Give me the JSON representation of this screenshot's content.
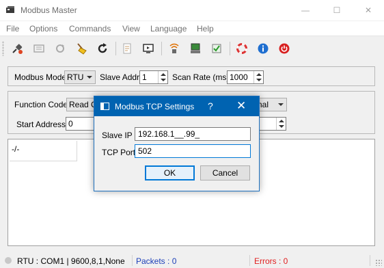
{
  "window": {
    "title": "Modbus Master",
    "controls": {
      "minimize": "—",
      "maximize": "☐",
      "close": "✕"
    }
  },
  "menu": [
    "File",
    "Options",
    "Commands",
    "View",
    "Language",
    "Help"
  ],
  "toolbar": {
    "icons": [
      "connect-icon",
      "disconnect-icon",
      "refresh-icon",
      "broom-icon",
      "reload-icon",
      "document-icon",
      "monitor-icon",
      "network-icon",
      "computer-icon",
      "check-icon",
      "lifebuoy-icon",
      "info-icon",
      "power-icon"
    ]
  },
  "mode_group": {
    "mode_label": "Modbus Mode",
    "mode_value": "RTU",
    "slave_label": "Slave Addr",
    "slave_value": "1",
    "rate_label": "Scan Rate (ms)",
    "rate_value": "1000"
  },
  "function_group": {
    "function_label": "Function Code",
    "function_value": "Read Co",
    "format_value": "imal",
    "start_label": "Start Address",
    "start_value": "0"
  },
  "data_area": {
    "cell": "-/-"
  },
  "status": {
    "connection": "RTU : COM1 | 9600,8,1,None",
    "packets": "Packets : 0",
    "errors": "Errors : 0",
    "packets_color": "#1c3fb8",
    "errors_color": "#e02020"
  },
  "dialog": {
    "title": "Modbus TCP Settings",
    "help": "?",
    "close": "✕",
    "ip_label": "Slave IP",
    "ip_value": "192.168.1__.99_",
    "port_label": "TCP Port",
    "port_value": "502",
    "ok_label": "OK",
    "cancel_label": "Cancel"
  }
}
